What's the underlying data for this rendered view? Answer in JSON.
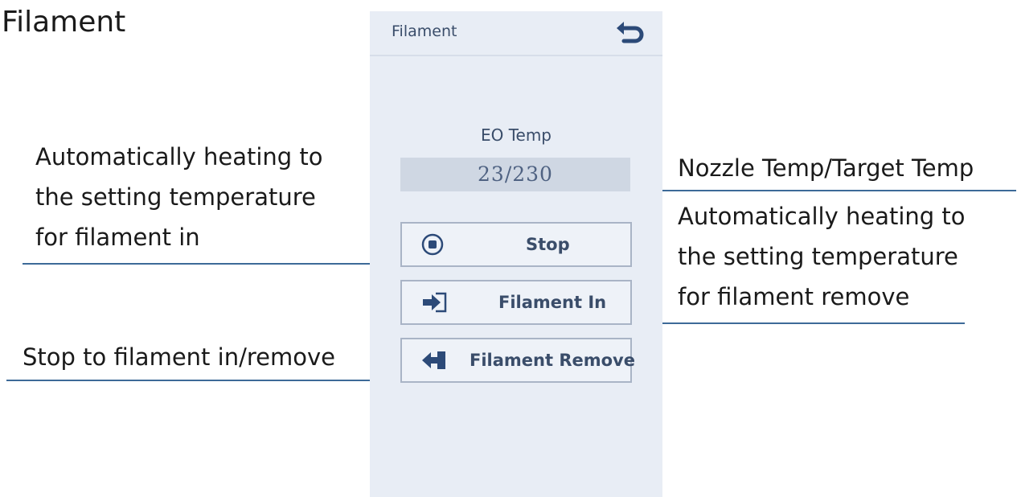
{
  "page": {
    "title": "Filament"
  },
  "panel": {
    "header_title": "Filament",
    "back_icon": "back-arrow-icon",
    "temp_label": "EO Temp",
    "temp_value": "23/230",
    "buttons": [
      {
        "label": "Stop",
        "icon": "stop-circle-icon"
      },
      {
        "label": "Filament In",
        "icon": "arrow-in-icon"
      },
      {
        "label": "Filament Remove",
        "icon": "arrow-out-icon"
      }
    ]
  },
  "callouts": {
    "left_top": "Automatically heating to\nthe setting temperature\nfor filament in",
    "left_bottom": "Stop to filament in/remove",
    "right_top": "Nozzle Temp/Target Temp",
    "right_middle": "Automatically heating to\nthe setting temperature\nfor filament remove"
  },
  "colors": {
    "line": "#3d6a98",
    "panel_bg": "#e8edf5",
    "accent": "#2c4a78"
  }
}
